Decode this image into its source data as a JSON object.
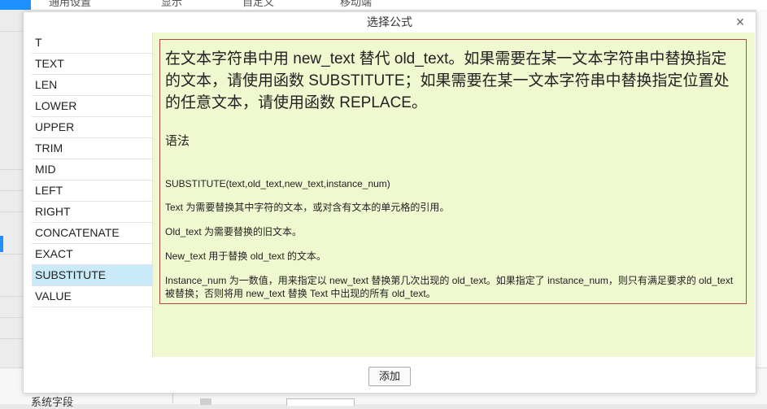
{
  "background": {
    "top_menu": [
      "通用设置",
      "显示",
      "自定义",
      "移动端"
    ],
    "bottom_label": "系统字段"
  },
  "dialog": {
    "title": "选择公式",
    "close_icon": "close-icon",
    "add_button_label": "添加"
  },
  "functions": [
    {
      "name": "T"
    },
    {
      "name": "TEXT"
    },
    {
      "name": "LEN"
    },
    {
      "name": "LOWER"
    },
    {
      "name": "UPPER"
    },
    {
      "name": "TRIM"
    },
    {
      "name": "MID"
    },
    {
      "name": "LEFT"
    },
    {
      "name": "RIGHT"
    },
    {
      "name": "CONCATENATE"
    },
    {
      "name": "EXACT"
    },
    {
      "name": "SUBSTITUTE"
    },
    {
      "name": "VALUE"
    }
  ],
  "selected_function": "SUBSTITUTE",
  "description": {
    "headline": "在文本字符串中用 new_text 替代 old_text。如果需要在某一文本字符串中替换指定的文本，请使用函数 SUBSTITUTE；如果需要在某一文本字符串中替换指定位置处的任意文本，请使用函数 REPLACE。",
    "syntax_heading": "语法",
    "syntax": "SUBSTITUTE(text,old_text,new_text,instance_num)",
    "params": [
      "Text 为需要替换其中字符的文本，或对含有文本的单元格的引用。",
      "Old_text 为需要替换的旧文本。",
      "New_text 用于替换 old_text 的文本。",
      "Instance_num 为一数值，用来指定以 new_text 替换第几次出现的 old_text。如果指定了 instance_num，则只有满足要求的 old_text 被替换；否则将用 new_text 替换 Text 中出现的所有 old_text。"
    ]
  },
  "colors": {
    "selected_row": "#c9ebf9",
    "description_background": "#eff8cf",
    "description_border": "#b04848",
    "accent": "#1e90ff"
  }
}
